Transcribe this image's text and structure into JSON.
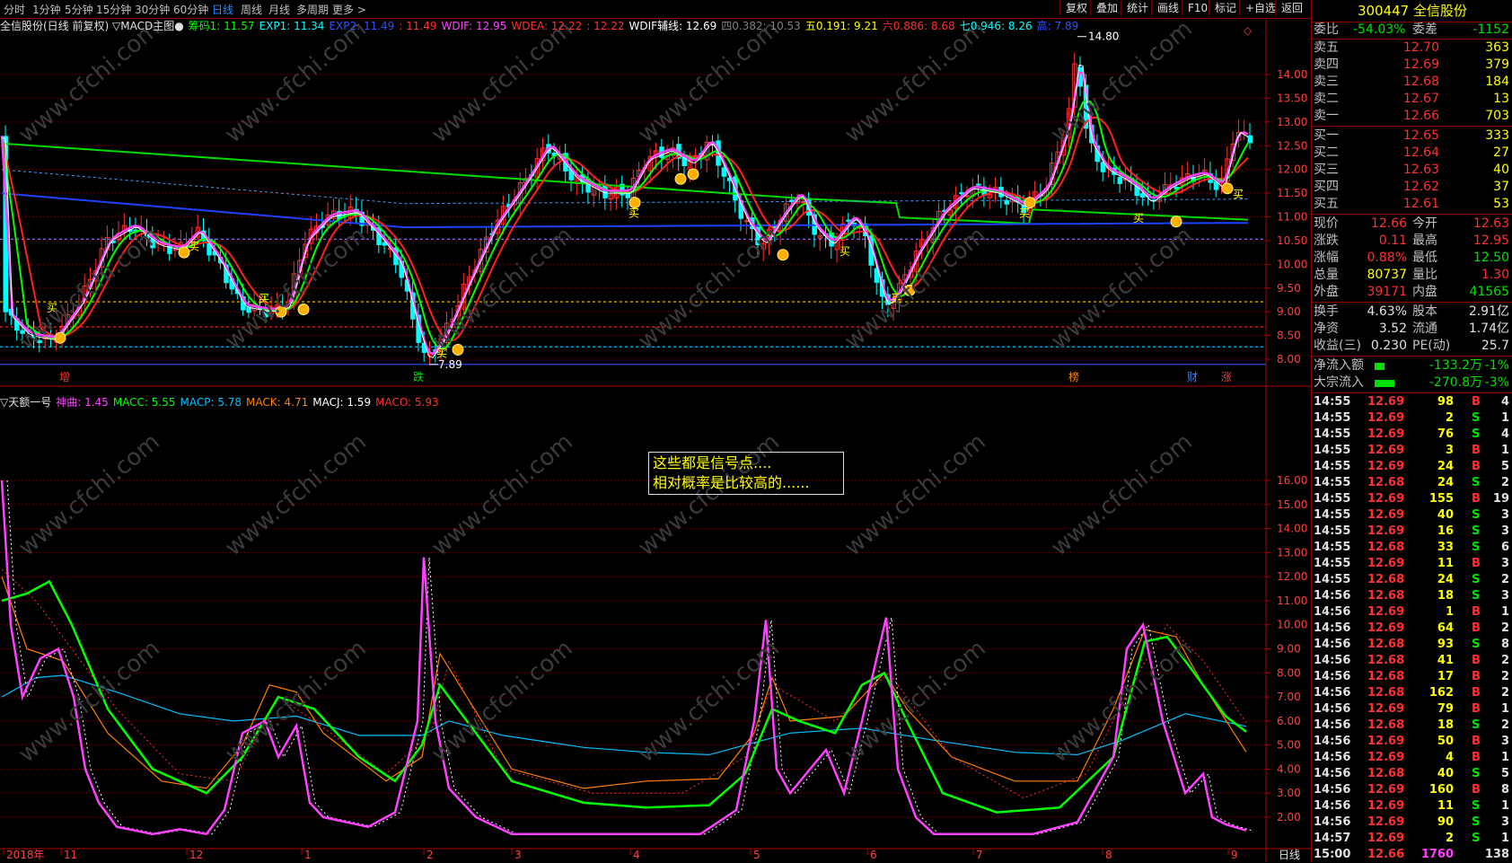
{
  "periods": [
    "分时",
    "1分钟",
    "5分钟",
    "15分钟",
    "30分钟",
    "60分钟",
    "日线",
    "周线",
    "月线",
    "多周期",
    "更多 >"
  ],
  "active_period": "日线",
  "toolbar": [
    "复权",
    "叠加",
    "统计",
    "画线",
    "F10",
    "标记",
    "+自选",
    "返回"
  ],
  "main_indicator": {
    "title": "全信股份(日线 前复权) ▽MACD主图●",
    "items": [
      {
        "text": "筹码1: 11.57",
        "color": "#00ff00"
      },
      {
        "text": "EXP1: 11.34",
        "color": "#00ffff"
      },
      {
        "text": "EXP2: 11.49",
        "color": "#3050ff"
      },
      {
        "text": ": 11.49",
        "color": "#ff3030"
      },
      {
        "text": "WDIF: 12.95",
        "color": "#ff40ff"
      },
      {
        "text": "WDEA: 12.22",
        "color": "#ff3030"
      },
      {
        "text": ": 12.22",
        "color": "#ff3030"
      },
      {
        "text": "WDIF辅线: 12.69",
        "color": "#ffffff"
      },
      {
        "text": "四0.382: 10.53",
        "color": "#808080"
      },
      {
        "text": "五0.191: 9.21",
        "color": "#ffff00"
      },
      {
        "text": "六0.886: 8.68",
        "color": "#ff3030"
      },
      {
        "text": "七0.946: 8.26",
        "color": "#00ffff"
      },
      {
        "text": "高: 7.89",
        "color": "#3050ff"
      }
    ]
  },
  "sub_indicator": {
    "title": "▽天额一号",
    "items": [
      {
        "text": "神曲: 1.45",
        "color": "#ff40ff"
      },
      {
        "text": "MACC: 5.55",
        "color": "#00ff00"
      },
      {
        "text": "MACP: 5.78",
        "color": "#00bfff"
      },
      {
        "text": "MACK: 4.71",
        "color": "#ff8000"
      },
      {
        "text": "MACJ: 1.59",
        "color": "#ffffff"
      },
      {
        "text": "MACO: 5.93",
        "color": "#ff3030"
      }
    ]
  },
  "price_axis": [
    "14.00",
    "13.50",
    "13.00",
    "12.50",
    "12.00",
    "11.50",
    "11.00",
    "10.50",
    "10.00",
    "9.50",
    "9.00",
    "8.50",
    "8.00"
  ],
  "osc_axis": [
    "16.00",
    "15.00",
    "14.00",
    "13.00",
    "12.00",
    "11.00",
    "10.00",
    "9.00",
    "8.00",
    "7.00",
    "6.00",
    "5.00",
    "4.00",
    "3.00",
    "2.00"
  ],
  "time_axis": [
    "2018年",
    "11",
    "12",
    "1",
    "2",
    "3",
    "4",
    "5",
    "6",
    "7",
    "8",
    "9"
  ],
  "time_axis_end": "日线",
  "max_label": "14.80",
  "min_label": "7.89",
  "buy_label": "买",
  "event_markers": [
    {
      "text": "增",
      "color": "#ff3030"
    },
    {
      "text": "跌",
      "color": "#00e000"
    },
    {
      "text": "榜",
      "color": "#ff8000"
    },
    {
      "text": "财",
      "color": "#3080ff"
    },
    {
      "text": "涨",
      "color": "#ff3030"
    }
  ],
  "annotation": [
    "这些都是信号点....",
    "相对概率是比较高的......"
  ],
  "watermark": "www.cfchi.com",
  "stock": {
    "code": "300447",
    "name": "全信股份"
  },
  "order_ratio": {
    "label1": "委比",
    "value1": "-54.03%",
    "label2": "委差",
    "value2": "-1152"
  },
  "asks": [
    {
      "label": "卖五",
      "price": "12.70",
      "vol": "363"
    },
    {
      "label": "卖四",
      "price": "12.69",
      "vol": "379"
    },
    {
      "label": "卖三",
      "price": "12.68",
      "vol": "184"
    },
    {
      "label": "卖二",
      "price": "12.67",
      "vol": "13"
    },
    {
      "label": "卖一",
      "price": "12.66",
      "vol": "703"
    }
  ],
  "bids": [
    {
      "label": "买一",
      "price": "12.65",
      "vol": "333"
    },
    {
      "label": "买二",
      "price": "12.64",
      "vol": "27"
    },
    {
      "label": "买三",
      "price": "12.63",
      "vol": "40"
    },
    {
      "label": "买四",
      "price": "12.62",
      "vol": "37"
    },
    {
      "label": "买五",
      "price": "12.61",
      "vol": "53"
    }
  ],
  "quote": [
    {
      "l1": "现价",
      "v1": "12.66",
      "c1": "red",
      "l2": "今开",
      "v2": "12.63",
      "c2": "red"
    },
    {
      "l1": "涨跌",
      "v1": "0.11",
      "c1": "red",
      "l2": "最高",
      "v2": "12.95",
      "c2": "red"
    },
    {
      "l1": "涨幅",
      "v1": "0.88%",
      "c1": "red",
      "l2": "最低",
      "v2": "12.50",
      "c2": "green"
    },
    {
      "l1": "总量",
      "v1": "80737",
      "c1": "yellow",
      "l2": "量比",
      "v2": "1.30",
      "c2": "red"
    },
    {
      "l1": "外盘",
      "v1": "39171",
      "c1": "red",
      "l2": "内盘",
      "v2": "41565",
      "c2": "green"
    }
  ],
  "fundamentals": [
    {
      "l1": "换手",
      "v1": "4.63%",
      "l2": "股本",
      "v2": "2.91亿"
    },
    {
      "l1": "净资",
      "v1": "3.52",
      "l2": "流通",
      "v2": "1.74亿"
    },
    {
      "l1": "收益(三)",
      "v1": "0.230",
      "l2": "PE(动)",
      "v2": "25.7"
    }
  ],
  "flows": [
    {
      "label": "净流入额",
      "value": "-133.2万",
      "pct": "-1%",
      "bar": 0.25
    },
    {
      "label": "大宗流入",
      "value": "-270.8万",
      "pct": "-3%",
      "bar": 0.5
    }
  ],
  "trades": [
    {
      "t": "14:55",
      "p": "12.69",
      "v": "98",
      "s": "B",
      "n": "4"
    },
    {
      "t": "14:55",
      "p": "12.69",
      "v": "2",
      "s": "S",
      "n": "1"
    },
    {
      "t": "14:55",
      "p": "12.69",
      "v": "76",
      "s": "S",
      "n": "4"
    },
    {
      "t": "14:55",
      "p": "12.69",
      "v": "3",
      "s": "B",
      "n": "1"
    },
    {
      "t": "14:55",
      "p": "12.69",
      "v": "24",
      "s": "B",
      "n": "5"
    },
    {
      "t": "14:55",
      "p": "12.68",
      "v": "24",
      "s": "S",
      "n": "2"
    },
    {
      "t": "14:55",
      "p": "12.69",
      "v": "155",
      "s": "B",
      "n": "19"
    },
    {
      "t": "14:55",
      "p": "12.69",
      "v": "40",
      "s": "S",
      "n": "3"
    },
    {
      "t": "14:55",
      "p": "12.69",
      "v": "16",
      "s": "S",
      "n": "3"
    },
    {
      "t": "14:55",
      "p": "12.68",
      "v": "33",
      "s": "S",
      "n": "6"
    },
    {
      "t": "14:55",
      "p": "12.69",
      "v": "11",
      "s": "B",
      "n": "3"
    },
    {
      "t": "14:55",
      "p": "12.68",
      "v": "24",
      "s": "S",
      "n": "2"
    },
    {
      "t": "14:56",
      "p": "12.68",
      "v": "18",
      "s": "S",
      "n": "3"
    },
    {
      "t": "14:56",
      "p": "12.69",
      "v": "1",
      "s": "B",
      "n": "1"
    },
    {
      "t": "14:56",
      "p": "12.69",
      "v": "64",
      "s": "B",
      "n": "2"
    },
    {
      "t": "14:56",
      "p": "12.68",
      "v": "93",
      "s": "S",
      "n": "8"
    },
    {
      "t": "14:56",
      "p": "12.68",
      "v": "41",
      "s": "B",
      "n": "2"
    },
    {
      "t": "14:56",
      "p": "12.68",
      "v": "17",
      "s": "B",
      "n": "2"
    },
    {
      "t": "14:56",
      "p": "12.68",
      "v": "162",
      "s": "B",
      "n": "2"
    },
    {
      "t": "14:56",
      "p": "12.69",
      "v": "79",
      "s": "B",
      "n": "1"
    },
    {
      "t": "14:56",
      "p": "12.68",
      "v": "18",
      "s": "S",
      "n": "2"
    },
    {
      "t": "14:56",
      "p": "12.69",
      "v": "50",
      "s": "B",
      "n": "3"
    },
    {
      "t": "14:56",
      "p": "12.69",
      "v": "4",
      "s": "B",
      "n": "1"
    },
    {
      "t": "14:56",
      "p": "12.68",
      "v": "40",
      "s": "S",
      "n": "5"
    },
    {
      "t": "14:56",
      "p": "12.69",
      "v": "160",
      "s": "B",
      "n": "8"
    },
    {
      "t": "14:56",
      "p": "12.69",
      "v": "11",
      "s": "S",
      "n": "1"
    },
    {
      "t": "14:56",
      "p": "12.69",
      "v": "90",
      "s": "S",
      "n": "3"
    },
    {
      "t": "14:57",
      "p": "12.69",
      "v": "2",
      "s": "S",
      "n": "1"
    },
    {
      "t": "15:00",
      "p": "12.66",
      "v": "1760",
      "s": "",
      "n": "138"
    }
  ],
  "colors": {
    "up": "#ff3030",
    "down": "#00ffff",
    "grid": "#800000",
    "bg": "#000000"
  }
}
